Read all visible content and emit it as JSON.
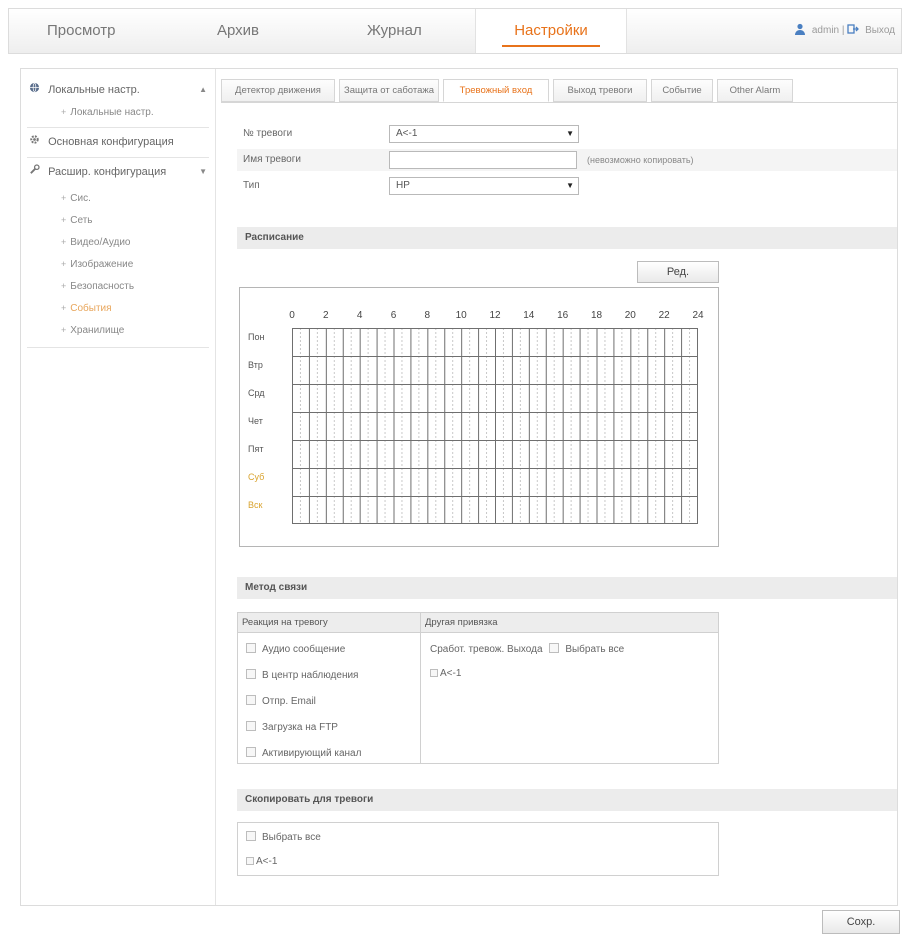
{
  "nav": {
    "items": [
      "Просмотр",
      "Архив",
      "Журнал",
      "Настройки"
    ],
    "active_index": 3,
    "user": "admin",
    "logout": "Выход"
  },
  "sidebar": {
    "sections": [
      {
        "label": "Локальные настр.",
        "icon": "globe-icon",
        "arrow": "▲"
      },
      {
        "label": "Основная конфигурация",
        "icon": "gear-icon"
      },
      {
        "label": "Расшир. конфигурация",
        "icon": "wrench-icon",
        "arrow": "▼"
      }
    ],
    "local_sub": "Локальные настр.",
    "advanced_subs": [
      "Сис.",
      "Сеть",
      "Видео/Аудио",
      "Изображение",
      "Безопасность",
      "События",
      "Хранилище"
    ],
    "active_sub": "События"
  },
  "tabs": {
    "items": [
      "Детектор движения",
      "Защита от саботажа",
      "Тревожный вход",
      "Выход тревоги",
      "Событие",
      "Other Alarm"
    ],
    "active_index": 2
  },
  "form": {
    "alarm_no_label": "№ тревоги",
    "alarm_no_value": "A<-1",
    "alarm_name_label": "Имя тревоги",
    "alarm_name_value": "",
    "alarm_name_hint": "(невозможно копировать)",
    "type_label": "Тип",
    "type_value": "НР"
  },
  "schedule": {
    "section_title": "Расписание",
    "edit_button": "Ред.",
    "hours": [
      "0",
      "2",
      "4",
      "6",
      "8",
      "10",
      "12",
      "14",
      "16",
      "18",
      "20",
      "22",
      "24"
    ],
    "days": [
      "Пон",
      "Втр",
      "Срд",
      "Чет",
      "Пят",
      "Суб",
      "Вск"
    ]
  },
  "linkage": {
    "section_title": "Метод связи",
    "normal_header": "Реакция на тревогу",
    "other_header": "Другая привязка",
    "normal_options": [
      "Аудио сообщение",
      "В центр наблюдения",
      "Отпр. Email",
      "Загрузка на FTP",
      "Активирующий канал"
    ],
    "trigger_label": "Сработ. тревож. Выхода",
    "select_all": "Выбрать все",
    "output_item": "A<-1"
  },
  "arming": {
    "section_title": "Скопировать для тревоги",
    "select_all": "Выбрать все",
    "item": "A<-1"
  },
  "save_button": "Сохр.",
  "colors": {
    "accent": "#e8731b",
    "weekend": "#d9a32e",
    "section_bg": "#ececec"
  }
}
